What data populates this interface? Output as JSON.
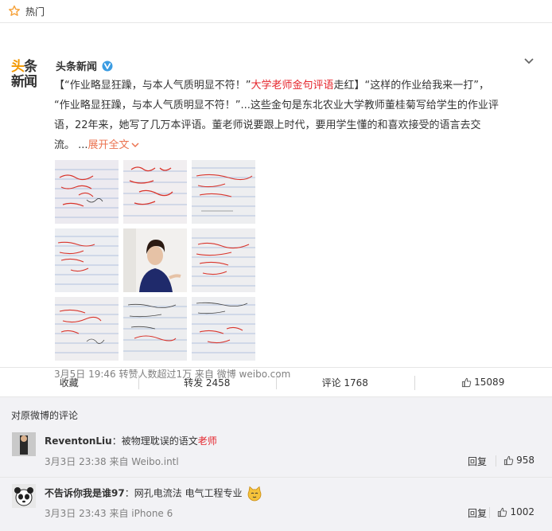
{
  "topbar": {
    "label": "热门"
  },
  "post": {
    "logo_top_a": "头",
    "logo_top_b": "条",
    "logo_bottom": "新闻",
    "author": "头条新闻",
    "text": {
      "p1": "【“作业略显狂躁，与本人气质明显不符！”",
      "p1_red": "大学老师金句评语",
      "p1b": "走红】“这样的作业给我来一打”，",
      "p2": "“作业略显狂躁，与本人气质明显不符！”...这些金句是东北农业大学教师董桂菊写给学生的作业评",
      "p3": "语，22年来，她写了几万本评语。董老师说要跟上时代，要用学生懂的和喜欢接受的语言去交",
      "p4": "流。 ...",
      "more": "展开全文"
    },
    "meta": "3月5日 19:46 转赞人数超过1万 来自 微博 weibo.com"
  },
  "actions": {
    "favorite": "收藏",
    "repost": "转发 2458",
    "comment": "评论 1768",
    "like": "15089"
  },
  "comments": {
    "title": "对原微博的评论",
    "items": [
      {
        "name": "ReventonLiu",
        "sep": "：",
        "text": "被物理耽误的语文",
        "text_red": "老师",
        "time": "3月3日 23:38 来自 Weibo.intl",
        "reply": "回复",
        "likes": "958"
      },
      {
        "name": "不告诉你我是谁97",
        "sep": "：",
        "text": "网孔电流法 电气工程专业",
        "text_red": "",
        "time": "3月3日 23:43 来自 iPhone 6",
        "reply": "回复",
        "likes": "1002"
      }
    ]
  },
  "colors": {
    "accent": "#eb7350",
    "red": "#e5242b",
    "logo_orange": "#f39800"
  }
}
